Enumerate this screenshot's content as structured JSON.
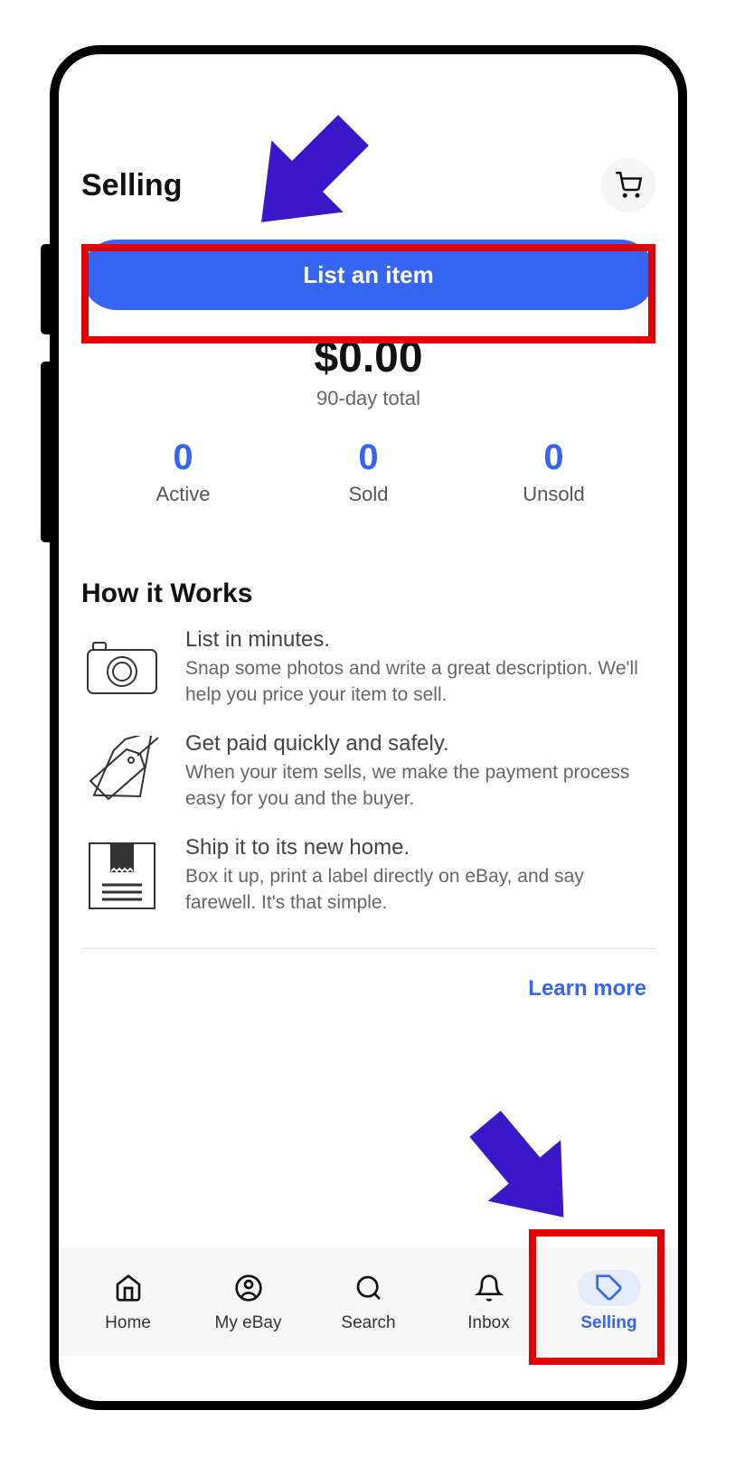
{
  "header": {
    "title": "Selling"
  },
  "actions": {
    "list_item_label": "List an item"
  },
  "summary": {
    "amount": "$0.00",
    "period": "90-day total",
    "stats": [
      {
        "count": "0",
        "label": "Active"
      },
      {
        "count": "0",
        "label": "Sold"
      },
      {
        "count": "0",
        "label": "Unsold"
      }
    ]
  },
  "how": {
    "title": "How it Works",
    "items": [
      {
        "heading": "List in minutes.",
        "body": "Snap some photos and write a great description. We'll help you price your item to sell."
      },
      {
        "heading": "Get paid quickly and safely.",
        "body": "When your item sells, we make the payment process easy for you and the buyer."
      },
      {
        "heading": "Ship it to its new home.",
        "body": "Box it up, print a label directly on eBay, and say farewell. It's that simple."
      }
    ],
    "learn_more": "Learn more"
  },
  "nav": {
    "items": [
      {
        "label": "Home"
      },
      {
        "label": "My eBay"
      },
      {
        "label": "Search"
      },
      {
        "label": "Inbox"
      },
      {
        "label": "Selling"
      }
    ]
  }
}
